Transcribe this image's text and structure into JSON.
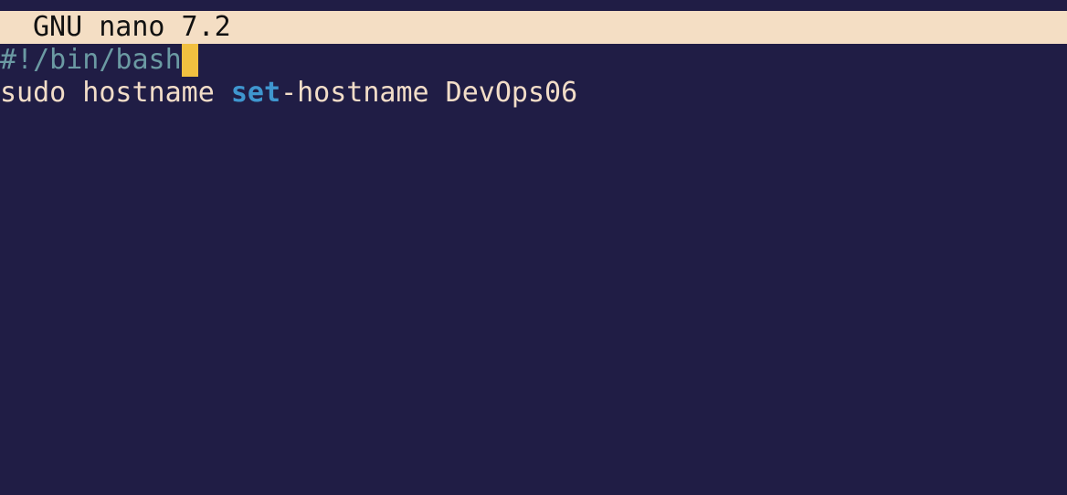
{
  "titlebar": {
    "title": "GNU nano 7.2"
  },
  "editor": {
    "line1": {
      "shebang": "#!/bin/bash"
    },
    "line2": {
      "part1": "sudo hostname ",
      "keyword": "set",
      "part2": "-hostname DevOps06"
    }
  },
  "colors": {
    "background": "#201d45",
    "titlebar_bg": "#f4dec4",
    "text": "#f2ddc8",
    "comment": "#6b9aa3",
    "keyword": "#3f96cf",
    "cursor": "#f1c040"
  }
}
